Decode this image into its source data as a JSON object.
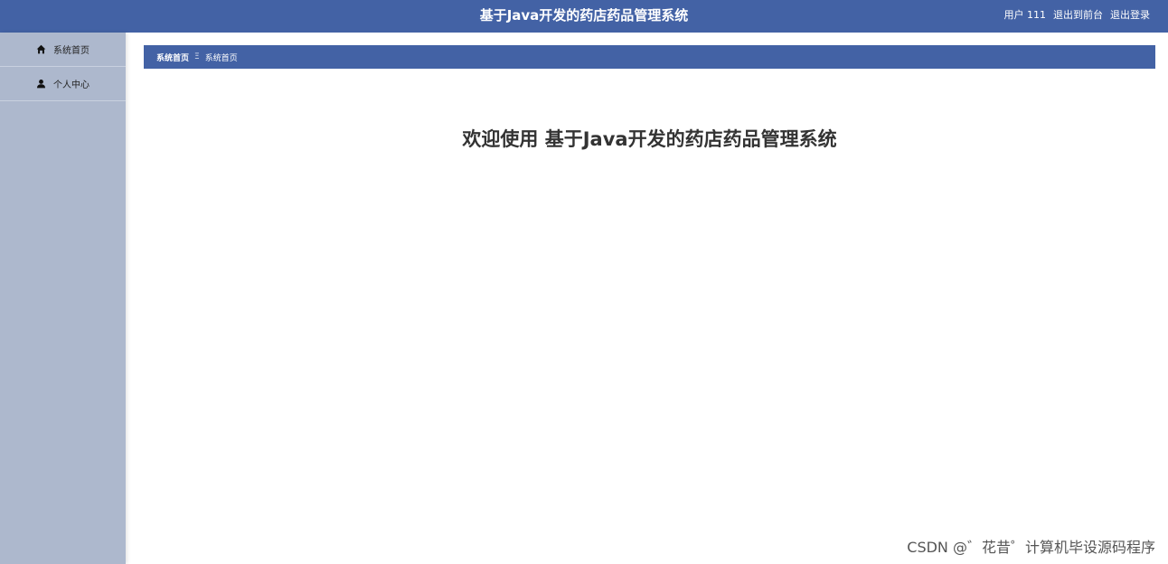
{
  "header": {
    "title": "基于Java开发的药店药品管理系统",
    "user_label": "用户 111",
    "frontend_link": "退出到前台",
    "logout_link": "退出登录"
  },
  "sidebar": {
    "items": [
      {
        "label": "系统首页",
        "icon": "home-icon"
      },
      {
        "label": "个人中心",
        "icon": "user-icon"
      }
    ]
  },
  "breadcrumb": {
    "root": "系统首页",
    "separator": "Ξ",
    "current": "系统首页"
  },
  "main": {
    "welcome": "欢迎使用 基于Java开发的药店药品管理系统"
  },
  "watermark": "CSDN @゛花昔゜计算机毕设源码程序",
  "colors": {
    "header_bg": "#4362a5",
    "sidebar_bg": "#adb8cd"
  }
}
